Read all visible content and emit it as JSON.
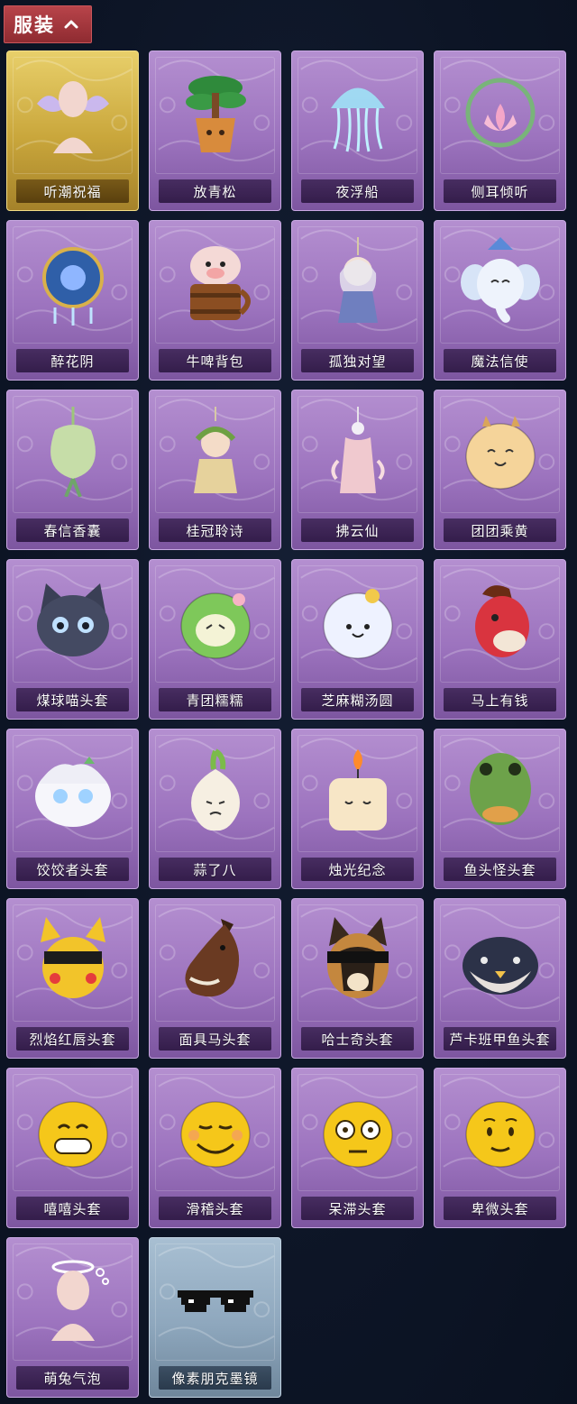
{
  "section": {
    "title": "服装",
    "caret_icon": "chevron-up-icon",
    "header_color": "#a53a40"
  },
  "items": [
    {
      "name": "听潮祝福",
      "icon": "angel-wings-figure-icon",
      "tier": "gold"
    },
    {
      "name": "放青松",
      "icon": "potted-pine-icon",
      "tier": "purple"
    },
    {
      "name": "夜浮船",
      "icon": "jellyfish-icon",
      "tier": "purple"
    },
    {
      "name": "侧耳倾听",
      "icon": "lotus-wreath-icon",
      "tier": "purple"
    },
    {
      "name": "醉花阴",
      "icon": "dreamcatcher-icon",
      "tier": "purple"
    },
    {
      "name": "牛啤背包",
      "icon": "cow-beer-mug-icon",
      "tier": "purple"
    },
    {
      "name": "孤独对望",
      "icon": "doll-pendant-icon",
      "tier": "purple"
    },
    {
      "name": "魔法信使",
      "icon": "elephant-icon",
      "tier": "purple"
    },
    {
      "name": "春信香囊",
      "icon": "sachet-icon",
      "tier": "purple"
    },
    {
      "name": "桂冠聆诗",
      "icon": "laurel-fairy-icon",
      "tier": "purple"
    },
    {
      "name": "拂云仙",
      "icon": "cloud-immortal-icon",
      "tier": "purple"
    },
    {
      "name": "团团乘黄",
      "icon": "round-beast-icon",
      "tier": "purple"
    },
    {
      "name": "煤球喵头套",
      "icon": "black-cat-head-icon",
      "tier": "purple"
    },
    {
      "name": "青团糯糯",
      "icon": "green-dumpling-icon",
      "tier": "purple"
    },
    {
      "name": "芝麻糊汤圆",
      "icon": "rice-ball-icon",
      "tier": "purple"
    },
    {
      "name": "马上有钱",
      "icon": "red-horse-head-icon",
      "tier": "purple"
    },
    {
      "name": "饺饺者头套",
      "icon": "dumpling-head-icon",
      "tier": "purple"
    },
    {
      "name": "蒜了八",
      "icon": "garlic-icon",
      "tier": "purple"
    },
    {
      "name": "烛光纪念",
      "icon": "candle-icon",
      "tier": "purple"
    },
    {
      "name": "鱼头怪头套",
      "icon": "fish-head-icon",
      "tier": "purple"
    },
    {
      "name": "烈焰红唇头套",
      "icon": "yellow-mouse-sunglasses-icon",
      "tier": "purple"
    },
    {
      "name": "面具马头套",
      "icon": "horse-mask-icon",
      "tier": "purple"
    },
    {
      "name": "哈士奇头套",
      "icon": "husky-sunglasses-icon",
      "tier": "purple"
    },
    {
      "name": "芦卡班甲鱼头套",
      "icon": "turtle-head-icon",
      "tier": "purple"
    },
    {
      "name": "嘻嘻头套",
      "icon": "grin-emoji-icon",
      "tier": "purple"
    },
    {
      "name": "滑稽头套",
      "icon": "smirk-emoji-icon",
      "tier": "purple"
    },
    {
      "name": "呆滞头套",
      "icon": "dazed-emoji-icon",
      "tier": "purple"
    },
    {
      "name": "卑微头套",
      "icon": "humble-emoji-icon",
      "tier": "purple"
    },
    {
      "name": "萌兔气泡",
      "icon": "bubble-halo-figure-icon",
      "tier": "purple"
    },
    {
      "name": "像素朋克墨镜",
      "icon": "pixel-sunglasses-icon",
      "tier": "blue"
    }
  ]
}
